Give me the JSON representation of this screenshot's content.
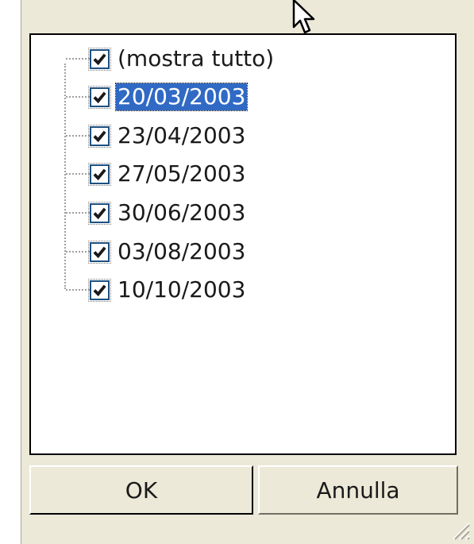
{
  "filter_list": {
    "items": [
      {
        "label": "(mostra tutto)",
        "checked": true,
        "selected": false
      },
      {
        "label": "20/03/2003",
        "checked": true,
        "selected": true
      },
      {
        "label": "23/04/2003",
        "checked": true,
        "selected": false
      },
      {
        "label": "27/05/2003",
        "checked": true,
        "selected": false
      },
      {
        "label": "30/06/2003",
        "checked": true,
        "selected": false
      },
      {
        "label": "03/08/2003",
        "checked": true,
        "selected": false
      },
      {
        "label": "10/10/2003",
        "checked": true,
        "selected": false
      }
    ]
  },
  "buttons": {
    "ok_label": "OK",
    "cancel_label": "Annulla"
  },
  "colors": {
    "selection": "#316ac5",
    "window_bg": "#ece9d8",
    "check": "#1a1a1a"
  },
  "icons": {
    "cursor": "mouse-pointer-icon",
    "grip": "resize-grip-icon",
    "check": "checkmark-icon"
  }
}
